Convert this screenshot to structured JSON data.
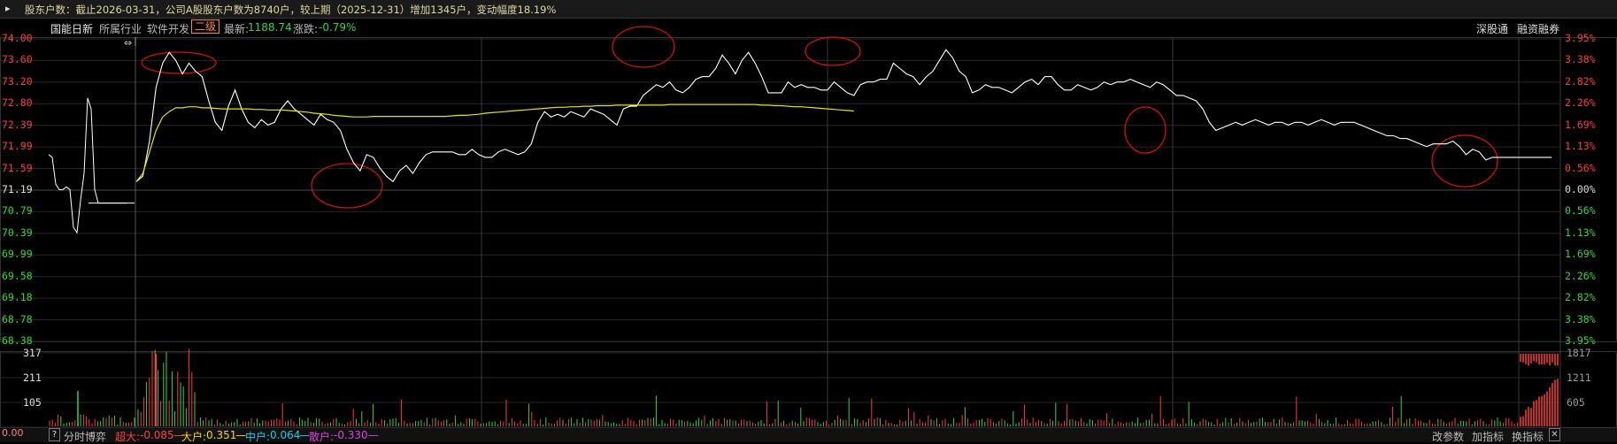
{
  "topbar": {
    "icon": "speaker-icon",
    "text": "股东户数：截止2026-03-31，公司A股股东户数为8740户，较上期（2025-12-31）增加1345户，变动幅度18.19%"
  },
  "infobar": {
    "stock_name": "国能日新",
    "industry_label": "所属行业",
    "industry_value": "软件开发",
    "level_badge": "二级",
    "latest_label": "最新:",
    "latest_value": "1188.74",
    "change_label": "涨跌:",
    "change_value": "-0.79%"
  },
  "header_buttons": {
    "shenzhen_connect": "深股通",
    "margin_trading": "融资融券"
  },
  "price_axis": {
    "left": [
      "74.00",
      "73.60",
      "73.20",
      "72.80",
      "72.39",
      "71.99",
      "71.59",
      "71.19",
      "70.79",
      "70.39",
      "69.99",
      "69.58",
      "69.18",
      "68.78",
      "68.38"
    ],
    "right": [
      "3.95%",
      "3.38%",
      "2.82%",
      "2.26%",
      "1.69%",
      "1.13%",
      "0.56%",
      "0.00%",
      "0.56%",
      "1.13%",
      "1.69%",
      "2.26%",
      "2.82%",
      "3.38%",
      "3.95%"
    ]
  },
  "volume_axis": {
    "left": [
      "317",
      "211",
      "105"
    ],
    "right": [
      "1817",
      "1211",
      "605"
    ]
  },
  "bottombar": {
    "help": "?",
    "tab": "分时博弈",
    "super_label": "超大:",
    "super_value": "-0.085",
    "large_label": "大户:",
    "large_value": "0.351",
    "mid_label": "中户:",
    "mid_value": "0.064",
    "small_label": "散户:",
    "small_value": "-0.330",
    "suffix": "—",
    "cut_value": "0.00",
    "btn_params": "改参数",
    "btn_add": "加指标",
    "btn_switch": "换指标",
    "btn_close": "✕"
  },
  "colors": {
    "up": "#ff3b3b",
    "down": "#3bd43b",
    "price_line": "#ffffff",
    "avg_line": "#e6e600",
    "grid": "#262626",
    "annotation": "#d01010"
  },
  "chart_data": {
    "type": "line",
    "series": [],
    "ylim": [
      68.38,
      74.0
    ],
    "price": [
      71.35,
      71.45,
      72.1,
      73.1,
      73.55,
      73.75,
      73.6,
      73.35,
      73.55,
      73.4,
      73.3,
      72.85,
      72.45,
      72.3,
      72.75,
      73.05,
      72.7,
      72.45,
      72.35,
      72.5,
      72.4,
      72.45,
      72.7,
      72.85,
      72.7,
      72.6,
      72.5,
      72.4,
      72.6,
      72.5,
      72.45,
      72.3,
      71.95,
      71.7,
      71.55,
      71.85,
      71.8,
      71.6,
      71.45,
      71.35,
      71.55,
      71.65,
      71.5,
      71.7,
      71.85,
      71.9,
      71.9,
      71.9,
      71.9,
      71.85,
      71.85,
      71.95,
      71.85,
      71.8,
      71.8,
      71.9,
      71.95,
      71.9,
      71.85,
      71.9,
      72.05,
      72.45,
      72.65,
      72.55,
      72.6,
      72.55,
      72.65,
      72.6,
      72.55,
      72.7,
      72.65,
      72.6,
      72.5,
      72.4,
      72.7,
      72.75,
      72.75,
      72.95,
      73.05,
      73.15,
      73.1,
      73.2,
      73.05,
      73.0,
      73.1,
      73.25,
      73.3,
      73.3,
      73.45,
      73.7,
      73.55,
      73.35,
      73.6,
      73.75,
      73.55,
      73.3,
      73.0,
      73.0,
      73.0,
      73.2,
      73.1,
      73.15,
      73.1,
      73.1,
      73.05,
      73.05,
      73.2,
      73.1,
      73.0,
      72.95,
      73.15,
      73.2,
      73.2,
      73.25,
      73.25,
      73.55,
      73.45,
      73.35,
      73.3,
      73.15,
      73.3,
      73.4,
      73.6,
      73.8,
      73.65,
      73.4,
      73.3,
      73.0,
      73.05,
      73.15,
      73.1,
      73.1,
      73.05,
      73.0,
      73.1,
      73.2,
      73.25,
      73.15,
      73.3,
      73.3,
      73.15,
      73.05,
      73.05,
      73.15,
      73.1,
      73.05,
      73.1,
      73.2,
      73.15,
      73.2,
      73.2,
      73.25,
      73.2,
      73.15,
      73.1,
      73.2,
      73.15,
      73.05,
      72.95,
      72.95,
      72.9,
      72.85,
      72.7,
      72.45,
      72.3,
      72.35,
      72.4,
      72.45,
      72.4,
      72.45,
      72.5,
      72.45,
      72.4,
      72.45,
      72.45,
      72.4,
      72.45,
      72.45,
      72.4,
      72.45,
      72.5,
      72.45,
      72.4,
      72.45,
      72.45,
      72.45,
      72.4,
      72.35,
      72.3,
      72.25,
      72.2,
      72.2,
      72.15,
      72.15,
      72.1,
      72.05,
      72.0,
      72.05,
      72.05,
      72.05,
      72.1,
      72.0,
      71.85,
      71.95,
      71.9,
      71.75,
      71.8,
      71.8,
      71.8,
      71.8,
      71.8,
      71.8,
      71.8,
      71.8,
      71.8,
      71.8
    ],
    "avg": [
      71.35,
      71.5,
      71.9,
      72.3,
      72.55,
      72.65,
      72.72,
      72.72,
      72.74,
      72.74,
      72.72,
      72.72,
      72.71,
      72.7,
      72.7,
      72.7,
      72.7,
      72.7,
      72.69,
      72.69,
      72.68,
      72.68,
      72.68,
      72.67,
      72.66,
      72.65,
      72.64,
      72.62,
      72.61,
      72.6,
      72.58,
      72.57,
      72.56,
      72.55,
      72.55,
      72.55,
      72.56,
      72.56,
      72.56,
      72.56,
      72.56,
      72.56,
      72.56,
      72.56,
      72.56,
      72.56,
      72.56,
      72.56,
      72.57,
      72.58,
      72.58,
      72.59,
      72.6,
      72.62,
      72.63,
      72.64,
      72.65,
      72.66,
      72.67,
      72.68,
      72.69,
      72.7,
      72.71,
      72.72,
      72.73,
      72.73,
      72.74,
      72.74,
      72.75,
      72.75,
      72.76,
      72.76,
      72.76,
      72.77,
      72.77,
      72.77,
      72.77,
      72.77,
      72.77,
      72.77,
      72.77,
      72.78,
      72.78,
      72.78,
      72.78,
      72.78,
      72.78,
      72.78,
      72.78,
      72.78,
      72.78,
      72.78,
      72.78,
      72.78,
      72.78,
      72.77,
      72.77,
      72.76,
      72.76,
      72.75,
      72.74,
      72.74,
      72.73,
      72.72,
      72.71,
      72.7,
      72.69,
      72.68,
      72.67,
      72.66
    ]
  }
}
